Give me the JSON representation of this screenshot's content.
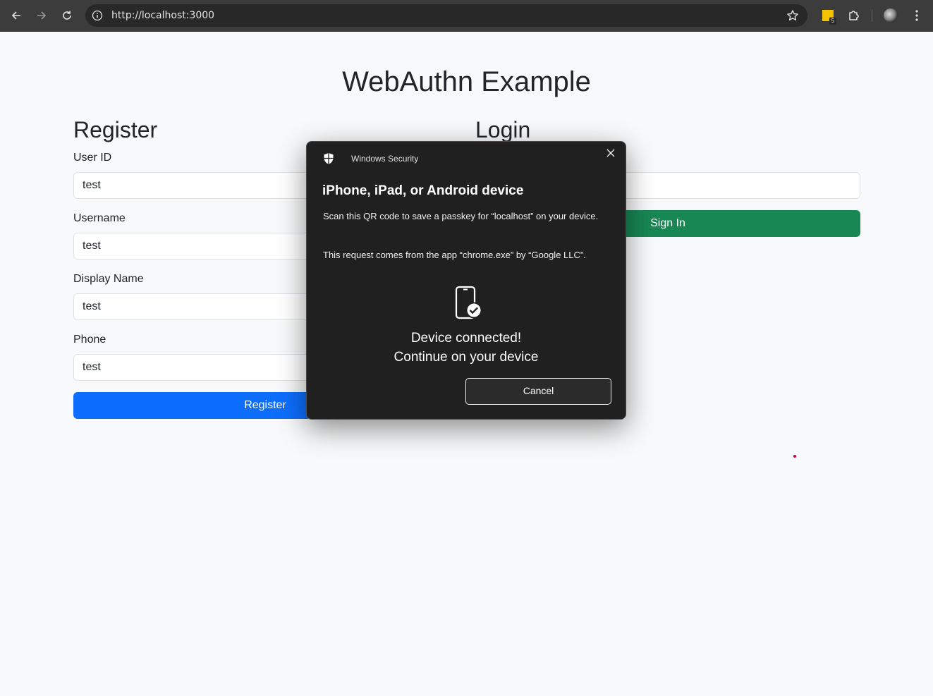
{
  "browser": {
    "url": "http://localhost:3000",
    "extension_badge": "5"
  },
  "page": {
    "title": "WebAuthn Example",
    "register": {
      "heading": "Register",
      "fields": [
        {
          "label": "User ID",
          "value": "test"
        },
        {
          "label": "Username",
          "value": "test"
        },
        {
          "label": "Display Name",
          "value": "test"
        },
        {
          "label": "Phone",
          "value": "test"
        }
      ],
      "button_label": "Register"
    },
    "login": {
      "heading": "Login",
      "button_label": "Sign In"
    }
  },
  "dialog": {
    "window_title": "Windows Security",
    "heading": "iPhone, iPad, or Android device",
    "paragraph1": "Scan this QR code to save a passkey for “localhost” on your device.",
    "paragraph2": "This request comes from the app “chrome.exe” by “Google LLC”.",
    "status_line1": "Device connected!",
    "status_line2": "Continue on your device",
    "cancel_label": "Cancel"
  },
  "colors": {
    "primary": "#0d6efd",
    "success": "#198754",
    "dialog_bg": "#202020"
  }
}
